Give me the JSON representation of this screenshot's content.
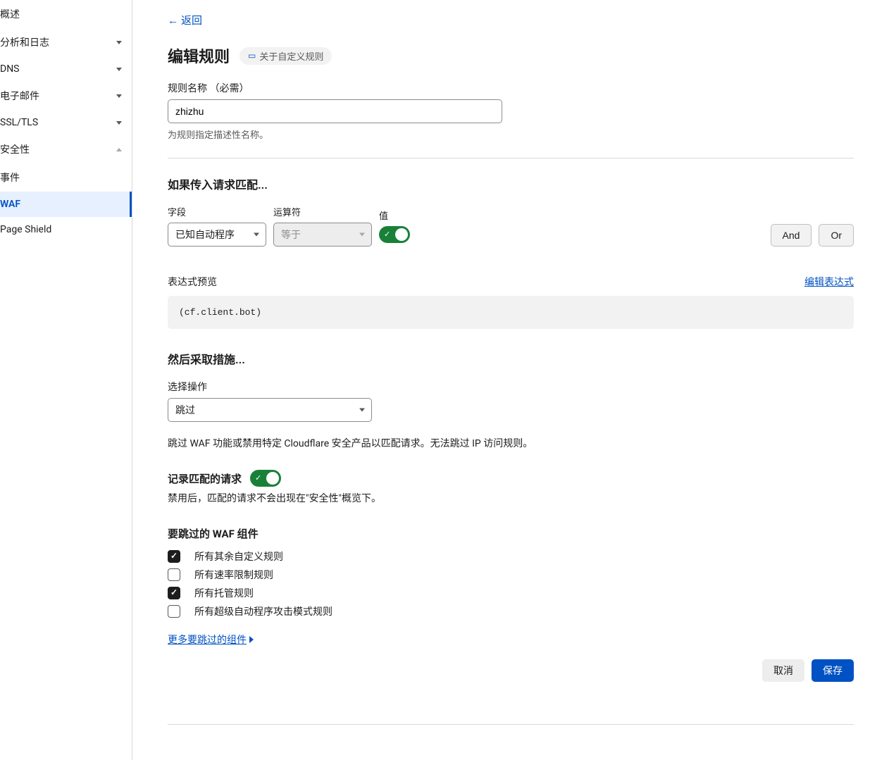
{
  "sidebar": {
    "items": [
      {
        "label": "概述",
        "expandable": false
      },
      {
        "label": "分析和日志",
        "expandable": true
      },
      {
        "label": "DNS",
        "expandable": true
      },
      {
        "label": "电子邮件",
        "expandable": true
      },
      {
        "label": "SSL/TLS",
        "expandable": true
      },
      {
        "label": "安全性",
        "expandable": true,
        "expanded": true
      },
      {
        "label": "事件",
        "sub": true
      },
      {
        "label": "WAF",
        "sub": true,
        "active": true
      },
      {
        "label": "Page Shield",
        "sub": true
      }
    ]
  },
  "back_label": "返回",
  "page_title": "编辑规则",
  "info_badge": "关于自定义规则",
  "rule_name": {
    "label": "规则名称  （必需）",
    "value": "zhizhu",
    "help": "为规则指定描述性名称。"
  },
  "match_section": {
    "title": "如果传入请求匹配...",
    "field_label": "字段",
    "field_value": "已知自动程序",
    "operator_label": "运算符",
    "operator_value": "等于",
    "value_label": "值",
    "and_label": "And",
    "or_label": "Or"
  },
  "expression": {
    "label": "表达式预览",
    "edit_link": "编辑表达式",
    "value": "(cf.client.bot)"
  },
  "action_section": {
    "title": "然后采取措施...",
    "select_label": "选择操作",
    "select_value": "跳过",
    "help": "跳过 WAF 功能或禁用特定 Cloudflare 安全产品以匹配请求。无法跳过 IP 访问规则。"
  },
  "log_section": {
    "label": "记录匹配的请求",
    "help": "禁用后，匹配的请求不会出现在\"安全性\"概览下。"
  },
  "skip_section": {
    "title": "要跳过的 WAF 组件",
    "options": [
      {
        "label": "所有其余自定义规则",
        "checked": true
      },
      {
        "label": "所有速率限制规则",
        "checked": false
      },
      {
        "label": "所有托管规则",
        "checked": true
      },
      {
        "label": "所有超级自动程序攻击模式规则",
        "checked": false
      }
    ],
    "more_link": "更多要跳过的组件"
  },
  "footer": {
    "cancel": "取消",
    "save": "保存"
  }
}
